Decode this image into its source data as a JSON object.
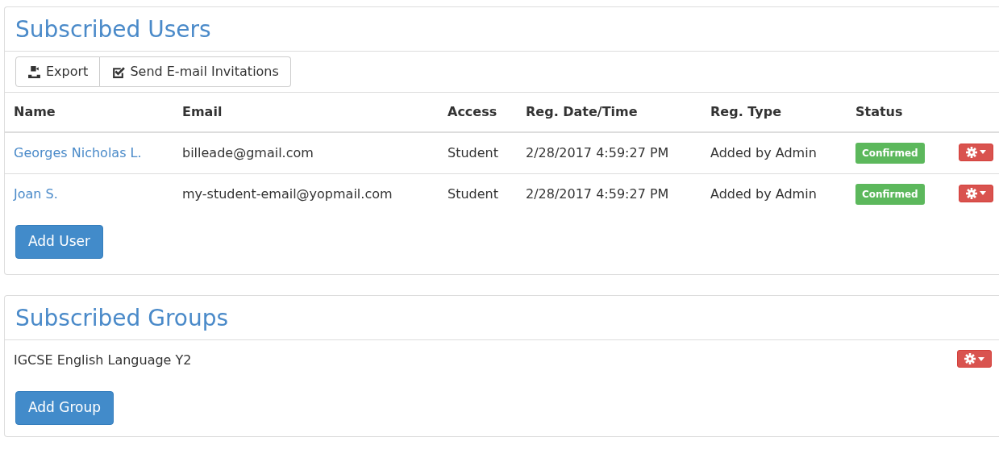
{
  "users_panel": {
    "title": "Subscribed Users",
    "toolbar": [
      {
        "label": "Export",
        "kind": "export"
      },
      {
        "label": "Send E-mail Invitations",
        "kind": "invite"
      }
    ],
    "columns": [
      "Name",
      "Email",
      "Access",
      "Reg. Date/Time",
      "Reg. Type",
      "Status"
    ],
    "rows": [
      {
        "name": "Georges Nicholas L.",
        "email": "billeade@gmail.com",
        "access": "Student",
        "reg_date": "2/28/2017 4:59:27 PM",
        "reg_type": "Added by Admin",
        "status": {
          "text": "Confirmed",
          "kind": "success"
        }
      },
      {
        "name": "Joan S.",
        "email": "my-student-email@yopmail.com",
        "access": "Student",
        "reg_date": "2/28/2017 4:59:27 PM",
        "reg_type": "Added by Admin",
        "status": {
          "text": "Confirmed",
          "kind": "success"
        }
      }
    ],
    "add_button": "Add User"
  },
  "groups_panel": {
    "title": "Subscribed Groups",
    "groups": [
      {
        "name": "IGCSE English Language Y2"
      }
    ],
    "add_button": "Add Group"
  }
}
